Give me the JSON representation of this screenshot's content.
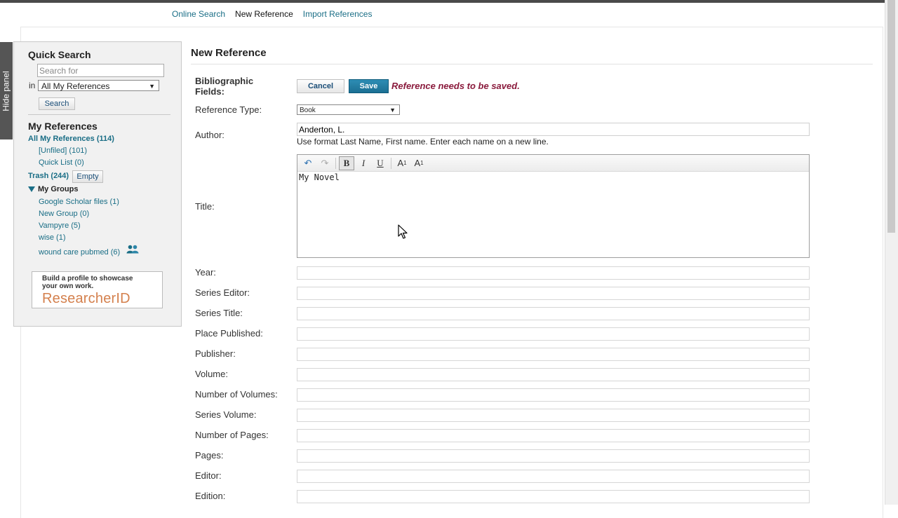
{
  "nav": {
    "online_search": "Online Search",
    "new_reference": "New Reference",
    "import_references": "Import References"
  },
  "hide_panel": "Hide panel",
  "quick_search": {
    "title": "Quick Search",
    "placeholder": "Search for",
    "in_label": "in",
    "scope_selected": "All My References",
    "search_button": "Search"
  },
  "my_references": {
    "title": "My References",
    "all": "All My References (114)",
    "unfiled": "[Unfiled] (101)",
    "quick_list": "Quick List (0)",
    "trash": "Trash (244)",
    "empty_button": "Empty",
    "groups_title": "My Groups",
    "groups": [
      {
        "label": "Google Scholar files  (1)"
      },
      {
        "label": "New Group  (0)"
      },
      {
        "label": "Vampyre  (5)"
      },
      {
        "label": "wise  (1)"
      },
      {
        "label": "wound care pubmed  (6)",
        "shared": true
      }
    ]
  },
  "promo": {
    "text": "Build a profile to showcase your own work.",
    "logo": "ResearcherID"
  },
  "form": {
    "page_title": "New Reference",
    "bib_fields_label": "Bibliographic Fields:",
    "cancel": "Cancel",
    "save": "Save",
    "warning": "Reference needs to be saved.",
    "reference_type_label": "Reference Type:",
    "reference_type_value": "Book",
    "author_label": "Author:",
    "author_value": "Anderton, L.",
    "author_hint": "Use format Last Name, First name. Enter each name on a new line.",
    "title_label": "Title:",
    "title_value": "My Novel",
    "fields": [
      {
        "label": "Year:"
      },
      {
        "label": "Series Editor:"
      },
      {
        "label": "Series Title:"
      },
      {
        "label": "Place Published:"
      },
      {
        "label": "Publisher:"
      },
      {
        "label": "Volume:"
      },
      {
        "label": "Number of Volumes:"
      },
      {
        "label": "Series Volume:"
      },
      {
        "label": "Number of Pages:"
      },
      {
        "label": "Pages:"
      },
      {
        "label": "Editor:"
      },
      {
        "label": "Edition:"
      }
    ]
  },
  "toolbar": {
    "undo": "↶",
    "redo": "↷",
    "bold": "B",
    "italic": "I",
    "underline": "U",
    "subscript": "A",
    "superscript": "A",
    "sub_mark": "1",
    "sup_mark": "1"
  },
  "colors": {
    "link": "#1a6e86",
    "warning": "#8a1a3c",
    "save_button": "#1b6f93",
    "promo_logo": "#d4804d"
  }
}
